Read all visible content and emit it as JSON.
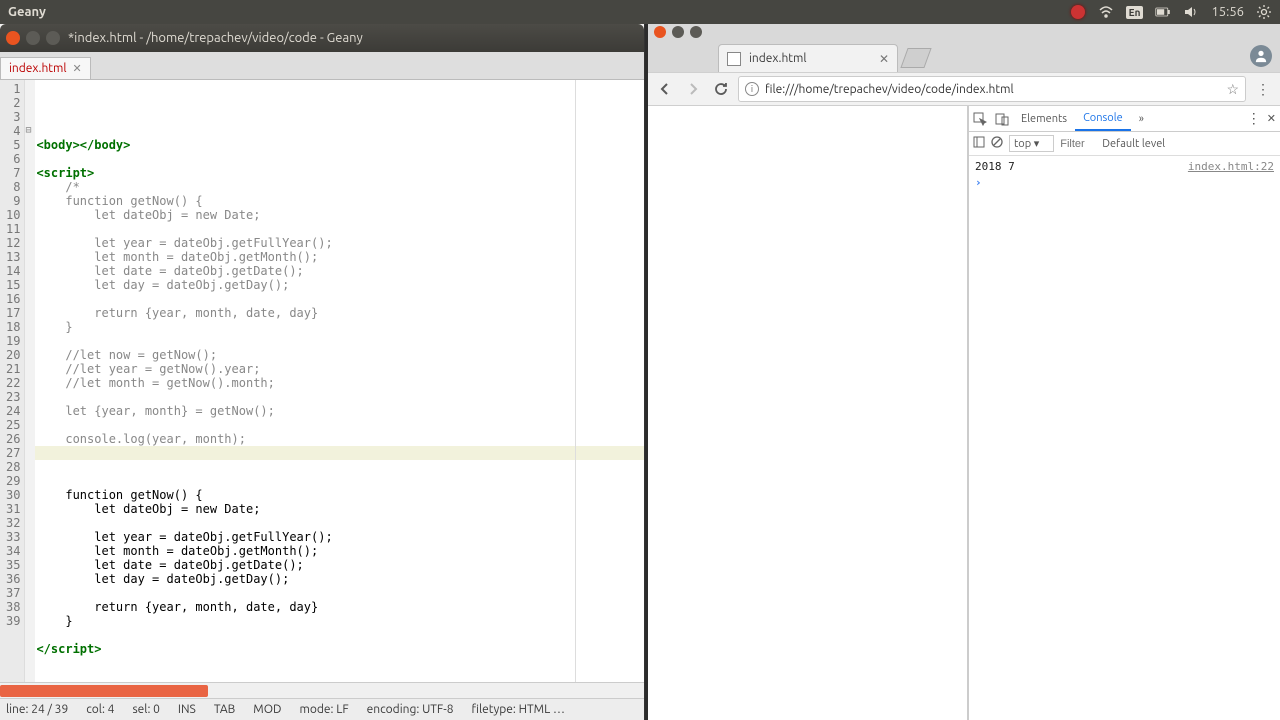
{
  "system": {
    "app_title": "Geany",
    "lang_indicator": "En",
    "clock": "15:56"
  },
  "geany": {
    "window_title": "*index.html - /home/trepachev/video/code - Geany",
    "tab_label": "index.html",
    "status": {
      "line": "line: 24 / 39",
      "col": "col: 4",
      "sel": "sel: 0",
      "ins": "INS",
      "tab": "TAB",
      "mod": "MOD",
      "mode": "mode: LF",
      "encoding": "encoding: UTF-8",
      "filetype": "filetype: HTML  …"
    },
    "code_lines": [
      {
        "n": 1,
        "html": ""
      },
      {
        "n": 2,
        "html": "<span class='tag'>&lt;body&gt;&lt;/body&gt;</span>"
      },
      {
        "n": 3,
        "html": ""
      },
      {
        "n": 4,
        "html": "<span class='tag'>&lt;script&gt;</span>"
      },
      {
        "n": 5,
        "html": "    <span class='com'>/*</span>"
      },
      {
        "n": 6,
        "html": "    <span class='com'>function getNow() {</span>"
      },
      {
        "n": 7,
        "html": "        <span class='com'>let dateObj = new Date;</span>"
      },
      {
        "n": 8,
        "html": ""
      },
      {
        "n": 9,
        "html": "        <span class='com'>let year = dateObj.getFullYear();</span>"
      },
      {
        "n": 10,
        "html": "        <span class='com'>let month = dateObj.getMonth();</span>"
      },
      {
        "n": 11,
        "html": "        <span class='com'>let date = dateObj.getDate();</span>"
      },
      {
        "n": 12,
        "html": "        <span class='com'>let day = dateObj.getDay();</span>"
      },
      {
        "n": 13,
        "html": ""
      },
      {
        "n": 14,
        "html": "        <span class='com'>return {year, month, date, day}</span>"
      },
      {
        "n": 15,
        "html": "    <span class='com'>}</span>"
      },
      {
        "n": 16,
        "html": ""
      },
      {
        "n": 17,
        "html": "    <span class='com'>//let now = getNow();</span>"
      },
      {
        "n": 18,
        "html": "    <span class='com'>//let year = getNow().year;</span>"
      },
      {
        "n": 19,
        "html": "    <span class='com'>//let month = getNow().month;</span>"
      },
      {
        "n": 20,
        "html": ""
      },
      {
        "n": 21,
        "html": "    <span class='com'>let {year, month} = getNow();</span>"
      },
      {
        "n": 22,
        "html": ""
      },
      {
        "n": 23,
        "html": "    <span class='com'>console.log(year, month);</span>"
      },
      {
        "n": 24,
        "html": "    ",
        "hl": true
      },
      {
        "n": 25,
        "html": ""
      },
      {
        "n": 26,
        "html": ""
      },
      {
        "n": 27,
        "html": "    <span class='blk'>function getNow() {</span>"
      },
      {
        "n": 28,
        "html": "        <span class='blk'>let dateObj = new Date;</span>"
      },
      {
        "n": 29,
        "html": ""
      },
      {
        "n": 30,
        "html": "        <span class='blk'>let year = dateObj.getFullYear();</span>"
      },
      {
        "n": 31,
        "html": "        <span class='blk'>let month = dateObj.getMonth();</span>"
      },
      {
        "n": 32,
        "html": "        <span class='blk'>let date = dateObj.getDate();</span>"
      },
      {
        "n": 33,
        "html": "        <span class='blk'>let day = dateObj.getDay();</span>"
      },
      {
        "n": 34,
        "html": ""
      },
      {
        "n": 35,
        "html": "        <span class='blk'>return {year, month, date, day}</span>"
      },
      {
        "n": 36,
        "html": "    <span class='blk'>}</span>"
      },
      {
        "n": 37,
        "html": ""
      },
      {
        "n": 38,
        "html": "<span class='tag'>&lt;/script&gt;</span>"
      },
      {
        "n": 39,
        "html": ""
      }
    ]
  },
  "chrome": {
    "tab_title": "index.html",
    "url": "file:///home/trepachev/video/code/index.html",
    "devtools": {
      "tabs": {
        "elements": "Elements",
        "console": "Console"
      },
      "context": "top",
      "filter_placeholder": "Filter",
      "levels": "Default level",
      "log_output": "2018 7",
      "log_source": "index.html:22"
    }
  }
}
